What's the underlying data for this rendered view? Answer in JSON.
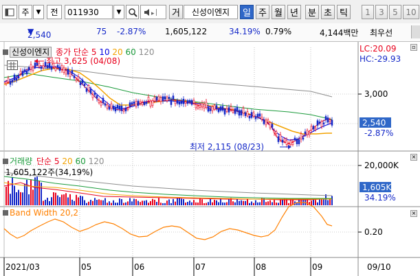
{
  "toolbar": {
    "market": "주",
    "type_label": "전",
    "code": "011930",
    "name_button": "거",
    "stock_name": "신성이엔지",
    "periods": [
      "일",
      "주",
      "월",
      "년",
      "분",
      "초",
      "틱"
    ],
    "selected_period": "일",
    "numbers": [
      "1",
      "3",
      "5",
      "10"
    ]
  },
  "quote": {
    "price": "2,540",
    "change": "75",
    "change_pct": "-2.87%",
    "volume": "1,605,122",
    "turnover": "34.19%",
    "ratio": "0.79%",
    "amount": "4,144백만",
    "bid_label": "최우선"
  },
  "price_panel": {
    "name": "신성이엔지",
    "legend_title": "종가 단순",
    "ma_periods": [
      "5",
      "10",
      "20",
      "60",
      "120"
    ],
    "ma_colors": [
      "#e8001c",
      "#0000e0",
      "#f2a200",
      "#1a9a3a",
      "#8c8c8c"
    ],
    "lc_label": "LC:20.09",
    "hc_label": "HC:-29.93",
    "high_annotation": "최고 3,625 (04/08)",
    "low_annotation": "최저 2,115 (08/23)",
    "y_tick": "3,000",
    "current_price": "2,540",
    "current_pct": "-2.87%"
  },
  "volume_panel": {
    "title": "거래량",
    "legend_title": "단순",
    "ma_periods": [
      "5",
      "20",
      "60",
      "120"
    ],
    "info": "1,605,122주(34,19%)",
    "y_tick": "20,000K",
    "current": "1,605K",
    "current_pct": "34.19%"
  },
  "band_panel": {
    "title": "Band Width 20,2",
    "y_tick": "0.20"
  },
  "x_axis": {
    "labels": [
      "2021/03",
      "05",
      "06",
      "07",
      "08",
      "09"
    ],
    "right_label": "09/10"
  },
  "colors": {
    "up": "#e8001c",
    "down": "#1428c8",
    "ma5": "#e8001c",
    "ma10": "#0000e0",
    "ma20": "#f2a200",
    "ma60": "#1a9a3a",
    "ma120": "#8c8c8c",
    "band": "#ff8000",
    "selected": "#2f67c8"
  }
}
